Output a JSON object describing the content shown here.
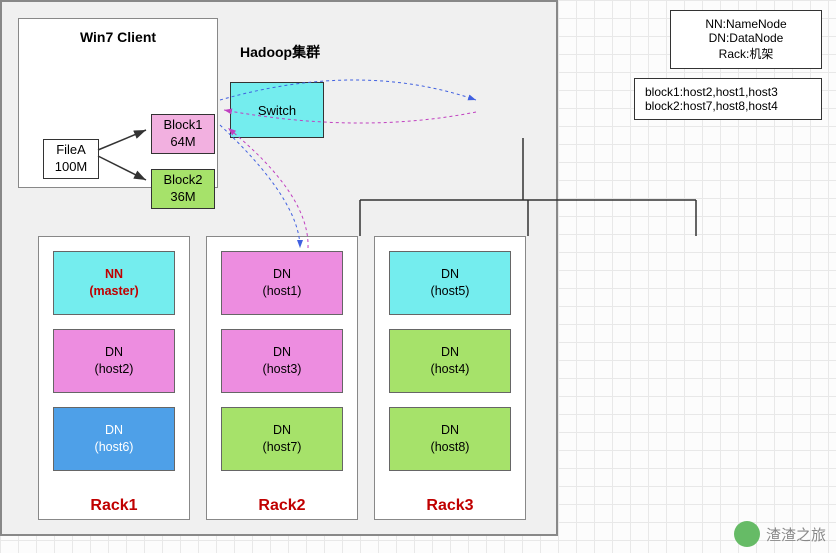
{
  "client": {
    "title": "Win7 Client",
    "file": {
      "name": "FileA",
      "size": "100M"
    },
    "block1": {
      "name": "Block1",
      "size": "64M"
    },
    "block2": {
      "name": "Block2",
      "size": "36M"
    }
  },
  "cluster": {
    "title": "Hadoop集群",
    "legend": {
      "nn": "NN:NameNode",
      "dn": "DN:DataNode",
      "rack": "Rack:机架"
    },
    "mapping": {
      "b1": "block1:host2,host1,host3",
      "b2": "block2:host7,host8,host4"
    },
    "switch_label": "Switch",
    "racks": [
      {
        "label": "Rack1",
        "nodes": [
          {
            "line1": "NN",
            "line2": "(master)",
            "style": "cyan red"
          },
          {
            "line1": "DN",
            "line2": "(host2)",
            "style": "mag"
          },
          {
            "line1": "DN",
            "line2": "(host6)",
            "style": "blue"
          }
        ]
      },
      {
        "label": "Rack2",
        "nodes": [
          {
            "line1": "DN",
            "line2": "(host1)",
            "style": "mag"
          },
          {
            "line1": "DN",
            "line2": "(host3)",
            "style": "mag"
          },
          {
            "line1": "DN",
            "line2": "(host7)",
            "style": "grn"
          }
        ]
      },
      {
        "label": "Rack3",
        "nodes": [
          {
            "line1": "DN",
            "line2": "(host5)",
            "style": "cyan"
          },
          {
            "line1": "DN",
            "line2": "(host4)",
            "style": "grn"
          },
          {
            "line1": "DN",
            "line2": "(host8)",
            "style": "grn"
          }
        ]
      }
    ]
  },
  "watermark": "渣渣之旅"
}
